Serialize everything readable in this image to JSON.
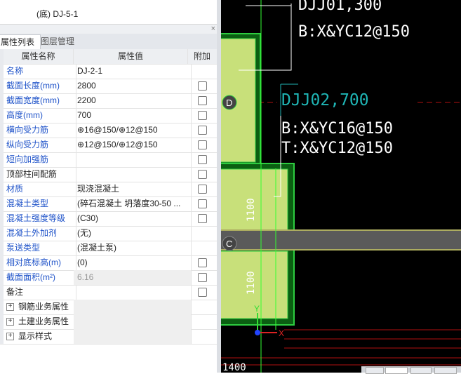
{
  "top_item": "(底) DJ-5-1",
  "panel": {
    "close_icon": "×"
  },
  "tabs": [
    {
      "label": "属性列表"
    },
    {
      "label": "图层管理"
    }
  ],
  "grid": {
    "headers": {
      "name": "属性名称",
      "value": "属性值",
      "add": "附加"
    },
    "rows": [
      {
        "name": "名称",
        "value": "DJ-2-1",
        "check": false,
        "color": "blue"
      },
      {
        "name": "截面长度(mm)",
        "value": "2800",
        "check": true,
        "color": "blue"
      },
      {
        "name": "截面宽度(mm)",
        "value": "2200",
        "check": true,
        "color": "blue"
      },
      {
        "name": "高度(mm)",
        "value": "700",
        "check": true,
        "color": "blue"
      },
      {
        "name": "横向受力筋",
        "value": "⊕16@150/⊕12@150",
        "check": true,
        "color": "blue"
      },
      {
        "name": "纵向受力筋",
        "value": "⊕12@150/⊕12@150",
        "check": true,
        "color": "blue"
      },
      {
        "name": "短向加强筋",
        "value": "",
        "check": true,
        "color": "blue"
      },
      {
        "name": "顶部柱间配筋",
        "value": "",
        "check": true,
        "color": "black"
      },
      {
        "name": "材质",
        "value": "现浇混凝土",
        "check": true,
        "color": "blue"
      },
      {
        "name": "混凝土类型",
        "value": "(碎石混凝土 坍落度30-50 ...",
        "check": true,
        "color": "blue"
      },
      {
        "name": "混凝土强度等级",
        "value": "(C30)",
        "check": true,
        "color": "blue"
      },
      {
        "name": "混凝土外加剂",
        "value": "(无)",
        "check": false,
        "color": "blue"
      },
      {
        "name": "泵送类型",
        "value": "(混凝土泵)",
        "check": false,
        "color": "blue"
      },
      {
        "name": "相对底标高(m)",
        "value": "(0)",
        "check": true,
        "color": "blue"
      },
      {
        "name": "截面面积(m²)",
        "value": "6.16",
        "check": true,
        "color": "blue",
        "readonly": true
      },
      {
        "name": "备注",
        "value": "",
        "check": true,
        "color": "black"
      }
    ],
    "groups": [
      {
        "label": "钢筋业务属性",
        "expand": "+"
      },
      {
        "label": "土建业务属性",
        "expand": "+"
      },
      {
        "label": "显示样式",
        "expand": "+"
      }
    ]
  },
  "canvas": {
    "texts": {
      "label_top": "DJJ01,300",
      "rebar_top": "B:X&YC12@150",
      "label_mid": "DJJ02,700",
      "rebar_mid_b": "B:X&YC16@150",
      "rebar_mid_t": "T:X&YC12@150",
      "axis_d": "D",
      "axis_c": "C",
      "dim_1": "1100",
      "dim_2": "1100",
      "dim_bottom": "1400",
      "axis_y": "Y",
      "axis_x": "X"
    },
    "colors": {
      "background": "#000000",
      "footing_fill": "#c8e07a",
      "footing_border": "#2ecc40",
      "cyan_text": "#1fb5b5",
      "white_text": "#ffffff",
      "axis_band": "#5a5a5a",
      "red_line": "#b01010"
    }
  }
}
